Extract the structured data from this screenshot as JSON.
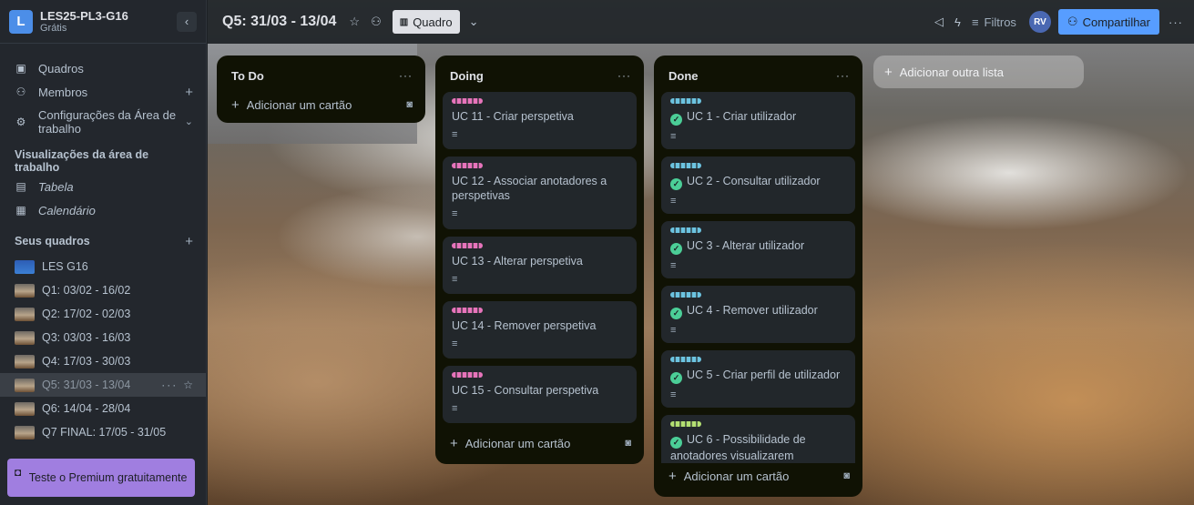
{
  "workspace": {
    "initial": "L",
    "name": "LES25-PL3-G16",
    "plan": "Grátis"
  },
  "sidebar": {
    "nav": [
      {
        "icon": "board-icon",
        "label": "Quadros"
      },
      {
        "icon": "members-icon",
        "label": "Membros"
      },
      {
        "icon": "settings-icon",
        "label": "Configurações da Área de trabalho"
      }
    ],
    "views_heading": "Visualizações da área de trabalho",
    "views": [
      {
        "icon": "table-icon",
        "label": "Tabela"
      },
      {
        "icon": "calendar-icon",
        "label": "Calendário"
      }
    ],
    "boards_heading": "Seus quadros",
    "boards": [
      {
        "label": "LES G16",
        "thumb": "blue"
      },
      {
        "label": "Q1: 03/02 - 16/02"
      },
      {
        "label": "Q2: 17/02 - 02/03"
      },
      {
        "label": "Q3: 03/03 - 16/03"
      },
      {
        "label": "Q4: 17/03 - 30/03"
      },
      {
        "label": "Q5: 31/03 - 13/04",
        "active": true
      },
      {
        "label": "Q6: 14/04 - 28/04"
      },
      {
        "label": "Q7 FINAL: 17/05 - 31/05"
      }
    ],
    "premium": "Teste o Premium gratuitamente"
  },
  "topbar": {
    "board_title": "Q5: 31/03 - 13/04",
    "view_label": "Quadro",
    "filters_label": "Filtros",
    "avatar_initials": "RV",
    "share_label": "Compartilhar"
  },
  "lists": [
    {
      "title": "To Do",
      "cards": [],
      "add_label": "Adicionar um cartão"
    },
    {
      "title": "Doing",
      "add_label": "Adicionar um cartão",
      "cards": [
        {
          "title": "UC 11 - Criar perspetiva",
          "label_color": "#e774bb",
          "done": false
        },
        {
          "title": "UC 12 - Associar anotadores a perspetivas",
          "label_color": "#e774bb",
          "done": false
        },
        {
          "title": "UC 13 - Alterar perspetiva",
          "label_color": "#e774bb",
          "done": false
        },
        {
          "title": "UC 14 - Remover perspetiva",
          "label_color": "#e774bb",
          "done": false
        },
        {
          "title": "UC 15 - Consultar perspetiva",
          "label_color": "#e774bb",
          "done": false
        }
      ]
    },
    {
      "title": "Done",
      "add_label": "Adicionar um cartão",
      "cards": [
        {
          "title": "UC 1 - Criar utilizador",
          "label_color": "#6cc3e0",
          "done": true
        },
        {
          "title": "UC 2 - Consultar utilizador",
          "label_color": "#6cc3e0",
          "done": true
        },
        {
          "title": "UC 3 - Alterar utilizador",
          "label_color": "#6cc3e0",
          "done": true
        },
        {
          "title": "UC 4 - Remover utilizador",
          "label_color": "#6cc3e0",
          "done": true
        },
        {
          "title": "UC 5 - Criar perfil de utilizador",
          "label_color": "#6cc3e0",
          "done": true
        },
        {
          "title": "UC 6 - Possibilidade de anotadores visualizarem",
          "label_color": "#b3df72",
          "done": true
        }
      ]
    }
  ],
  "add_list_label": "Adicionar outra lista"
}
